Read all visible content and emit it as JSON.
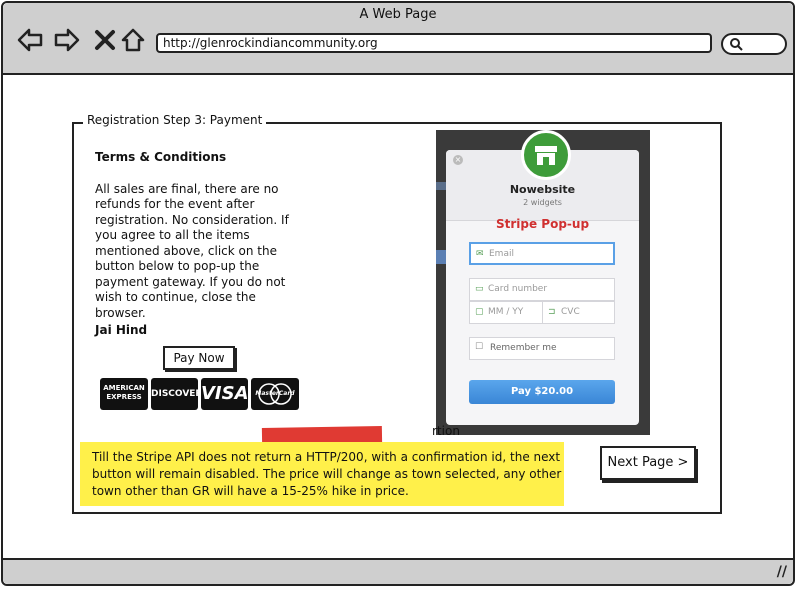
{
  "browser": {
    "window_title": "A Web Page",
    "url": "http://glenrockindiancommunity.org",
    "search_placeholder": ""
  },
  "panel": {
    "legend": "Registration Step 3: Payment",
    "terms_heading": "Terms & Conditions",
    "terms_body": "All sales are final, there are no refunds for the event after registration. No consideration. If you agree to all the items mentioned above, click on the button below to pop-up the payment gateway. If you do not wish to continue, close the browser.",
    "signoff": "Jai Hind",
    "pay_now_label": "Pay Now",
    "cards": [
      "AMERICAN EXPRESS",
      "DISCOVER",
      "VISA",
      "MasterCard"
    ]
  },
  "stripe": {
    "merchant": "Nowebsite",
    "subtitle": "2 widgets",
    "overlay_label": "Stripe Pop-up",
    "email_placeholder": "Email",
    "card_placeholder": "Card number",
    "expiry_placeholder": "MM / YY",
    "cvc_placeholder": "CVC",
    "remember_label": "Remember me",
    "pay_label": "Pay $20.00"
  },
  "under_text": "rtion",
  "note": "Till the Stripe API does not return a HTTP/200, with a confirmation id, the next button will remain disabled. The price will change as town selected, any other town other than GR will have a 15-25% hike in price.",
  "next_label": "Next Page >",
  "colors": {
    "chrome": "#cfcfcf",
    "highlight": "#fff04a",
    "stripe_accent": "#3a86d6",
    "ribbon": "#e03a33",
    "overlay_label": "#d03030"
  }
}
